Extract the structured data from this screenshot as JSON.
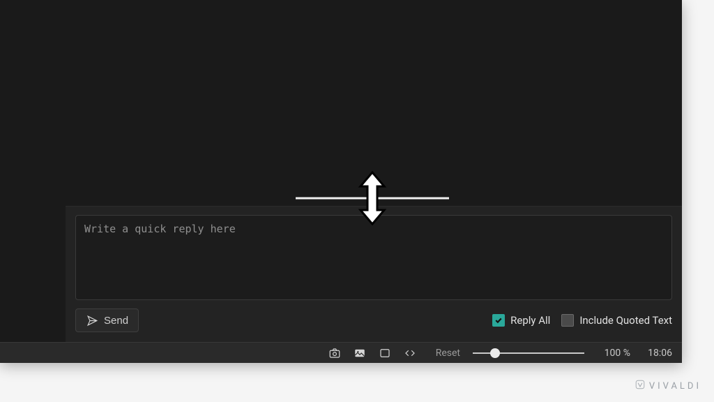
{
  "reply": {
    "placeholder": "Write a quick reply here",
    "send_label": "Send",
    "reply_all": {
      "label": "Reply All",
      "checked": true
    },
    "include_quoted": {
      "label": "Include Quoted Text",
      "checked": false
    }
  },
  "statusbar": {
    "reset_label": "Reset",
    "zoom": {
      "percent_label": "100 %",
      "value": 100,
      "min": 0,
      "max": 500,
      "thumb_pct": 20
    },
    "clock": "18:06"
  },
  "brand": {
    "name": "VIVALDI"
  }
}
